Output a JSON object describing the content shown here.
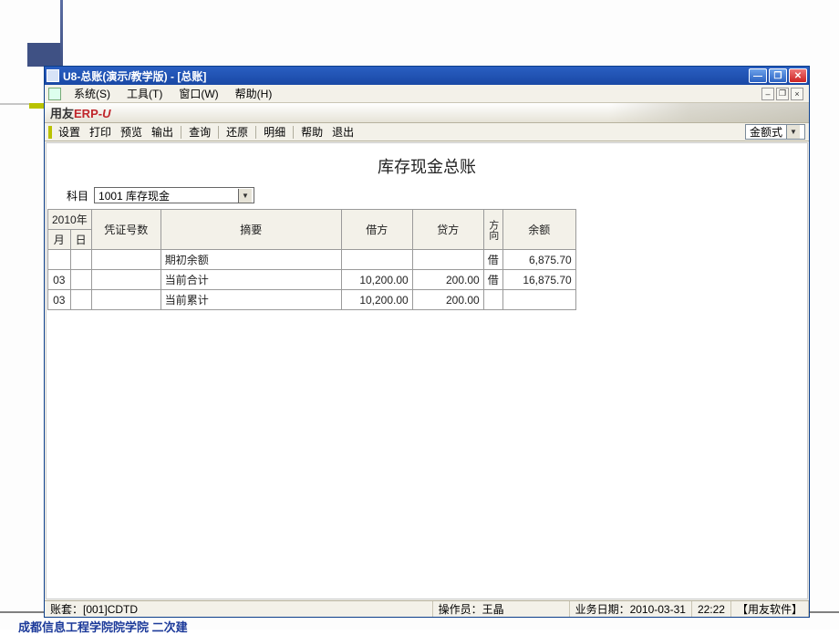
{
  "window": {
    "title": "U8-总账(演示/教学版) - [总账]"
  },
  "menubar": {
    "items": [
      "系统(S)",
      "工具(T)",
      "窗口(W)",
      "帮助(H)"
    ]
  },
  "brand": {
    "prefix": "用友",
    "erp": "ERP-",
    "suffix_icon": "U8"
  },
  "toolbar": {
    "items": [
      "设置",
      "打印",
      "预览",
      "输出"
    ],
    "items2": [
      "查询"
    ],
    "items3": [
      "还原"
    ],
    "items4": [
      "明细"
    ],
    "items5": [
      "帮助",
      "退出"
    ],
    "mode_label": "金额式"
  },
  "report": {
    "title": "库存现金总账",
    "subject_label": "科目",
    "subject_value": "1001 库存现金"
  },
  "grid": {
    "year_header": "2010年",
    "month_header": "月",
    "day_header": "日",
    "headers": {
      "voucher": "凭证号数",
      "summary": "摘要",
      "debit": "借方",
      "credit": "贷方",
      "direction": "方向",
      "balance": "余额"
    },
    "rows": [
      {
        "month": "",
        "day": "",
        "voucher": "",
        "summary": "期初余额",
        "debit": "",
        "credit": "",
        "direction": "借",
        "balance": "6,875.70",
        "alt": true
      },
      {
        "month": "03",
        "day": "",
        "voucher": "",
        "summary": "当前合计",
        "debit": "10,200.00",
        "credit": "200.00",
        "direction": "借",
        "balance": "16,875.70",
        "alt": false
      },
      {
        "month": "03",
        "day": "",
        "voucher": "",
        "summary": "当前累计",
        "debit": "10,200.00",
        "credit": "200.00",
        "direction": "",
        "balance": "",
        "alt": true
      }
    ]
  },
  "status": {
    "account_set": "账套：[001]CDTD",
    "operator": "操作员：王晶",
    "biz_date": "业务日期：2010-03-31",
    "time": "22:22",
    "vendor": "【用友软件】"
  },
  "footer_watermark": "成都信息工程学院院学院  二次建"
}
